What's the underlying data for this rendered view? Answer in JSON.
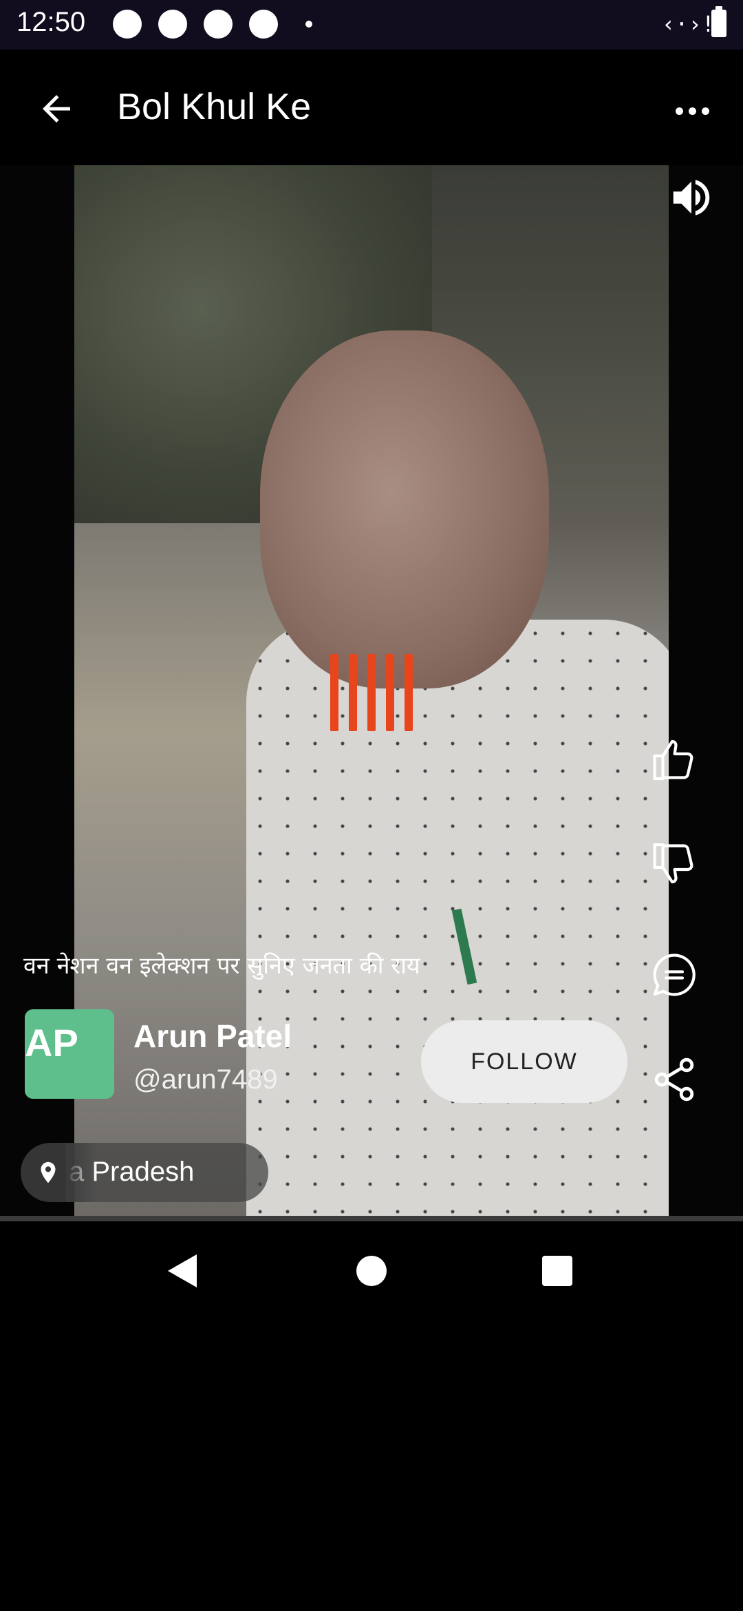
{
  "status_bar": {
    "time": "12:50"
  },
  "app_bar": {
    "title": "Bol Khul Ke"
  },
  "post": {
    "caption": "वन नेशन वन इलेक्शन पर सुनिए जनता की राय",
    "avatar_initials": "AP",
    "user_name": "Arun Patel",
    "user_handle": "@arun7489",
    "follow_label": "FOLLOW",
    "location": "a Pradesh"
  },
  "icons": {
    "back": "arrow-back-icon",
    "more": "more-horizontal-icon",
    "sound": "volume-icon",
    "like": "thumbs-up-icon",
    "dislike": "thumbs-down-icon",
    "comment": "comment-icon",
    "share": "share-icon",
    "location": "location-pin-icon"
  },
  "colors": {
    "loader": "#e8451c",
    "avatar_bg": "#5fbf8c",
    "status_bar_bg": "#120c1f"
  }
}
